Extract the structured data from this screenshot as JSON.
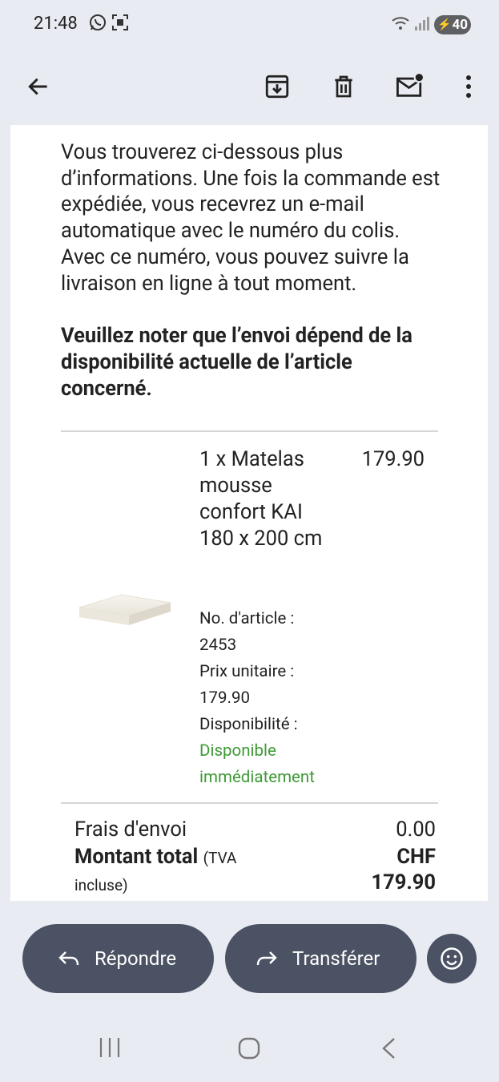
{
  "status_bar": {
    "time": "21:48",
    "battery": "40"
  },
  "toolbar": {
    "back": "back",
    "archive": "archive",
    "delete": "delete",
    "mark_unread": "mark unread",
    "more": "more options"
  },
  "email": {
    "intro": "Vous trouverez ci-dessous plus d’informations. Une fois la commande est expédiée, vous recevrez un e-mail automatique avec le numéro du colis. Avec ce numéro, vous pouvez suivre la livraison en ligne à tout moment.",
    "note": "Veuillez noter que l’envoi dépend de la disponibilité actuelle de l’article concerné.",
    "item": {
      "name": "1 x Matelas mousse confort KAI 180 x 200 cm",
      "price": "179.90",
      "article_label": "No. d'article :",
      "article_no": "2453",
      "unit_price_label": "Prix unitaire :",
      "unit_price": "179.90",
      "availability_label": "Disponibilité :",
      "availability": "Disponible immédiatement"
    },
    "shipping_label": "Frais d'envoi",
    "shipping_value": "0.00",
    "total_label": "Montant total",
    "total_tax_note_a": "(TVA",
    "total_tax_note_b": "incluse)",
    "total_currency": "CHF",
    "total_value": "179.90"
  },
  "actions": {
    "reply": "Répondre",
    "forward": "Transférer"
  },
  "colors": {
    "pill": "#4b5264",
    "available": "#3d9a35",
    "background": "#e9ebf2"
  }
}
